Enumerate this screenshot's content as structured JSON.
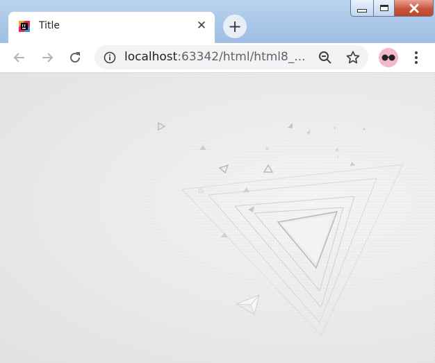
{
  "window": {
    "minimize_icon": "minimize-icon",
    "maximize_icon": "maximize-icon",
    "close_icon": "close-icon"
  },
  "tab": {
    "title": "Title",
    "favicon": "intellij-icon",
    "close_glyph": "✕"
  },
  "new_tab": {
    "glyph": "+"
  },
  "toolbar": {
    "back_icon": "back-arrow-icon",
    "forward_icon": "forward-arrow-icon",
    "reload_icon": "reload-icon",
    "info_icon": "info-icon",
    "zoom_icon": "zoom-out-icon",
    "bookmark_icon": "star-icon",
    "menu_icon": "kebab-menu-icon"
  },
  "address_bar": {
    "host": "localhost",
    "rest": ":63342/html/html8_..."
  },
  "colors": {
    "titlebar": "#a9c6e8",
    "close_button": "#c8553e",
    "page_background": "#ececec",
    "profile_avatar": "#f4b8c8"
  }
}
